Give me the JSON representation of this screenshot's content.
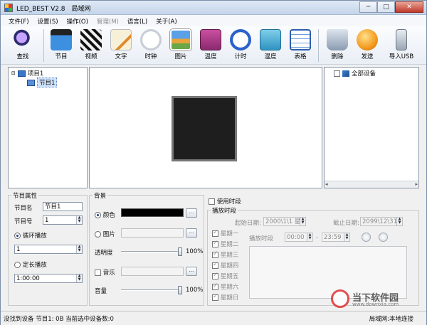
{
  "window": {
    "title": "LED_BEST V2.8　局域网",
    "minimize": "─",
    "maximize": "□",
    "close": "✕"
  },
  "menu": [
    {
      "label": "文件(F)",
      "enabled": true
    },
    {
      "label": "设置(S)",
      "enabled": true
    },
    {
      "label": "操作(O)",
      "enabled": true
    },
    {
      "label": "管理(M)",
      "enabled": false
    },
    {
      "label": "语言(L)",
      "enabled": true
    },
    {
      "label": "关于(A)",
      "enabled": true
    }
  ],
  "toolbar": {
    "find": "查找",
    "program": "节目",
    "video": "视频",
    "text": "文字",
    "clock": "时钟",
    "picture": "图片",
    "temperature": "温度",
    "timer": "计时",
    "humidity": "湿度",
    "table": "表格",
    "delete": "删除",
    "send": "发送",
    "export_usb": "导入USB"
  },
  "tree": {
    "root": "项目1",
    "child": "节目1"
  },
  "devices": {
    "all_devices": "全部设备"
  },
  "program_props": {
    "legend": "节目属性",
    "name_label": "节目名",
    "name_value": "节目1",
    "number_label": "节目号",
    "number_value": "1",
    "loop_label": "循环播放",
    "loop_value": "1",
    "fixed_label": "定长播放",
    "fixed_value": "1:00:00"
  },
  "background": {
    "legend": "背景",
    "color_label": "颜色",
    "color_value": "#000000",
    "picture_label": "图片",
    "browse": "...",
    "transparency_label": "透明度",
    "transparency_pct": "100%",
    "transparency": 1.0,
    "music_label": "音乐",
    "volume_label": "音量",
    "volume_pct": "100%",
    "volume": 1.0
  },
  "schedule": {
    "enable_label": "使用时段",
    "legend": "播放时段",
    "start_date_label": "起始日期:",
    "start_date": "2000\\1\\1 星",
    "end_date_label": "截止日期:",
    "end_date": "2099\\12\\31",
    "days": [
      "星期一",
      "星期二",
      "星期三",
      "星期四",
      "星期五",
      "星期六",
      "星期日"
    ],
    "time_label": "播放时段",
    "time_start": "00:00",
    "time_sep": "-",
    "time_end": "23:59"
  },
  "status": {
    "left": "没找到设备  节目1: 0B  当前选中设备数:0",
    "right": "局域网:本地连接"
  },
  "watermark": {
    "text": "当下软件园",
    "url": "www.downxia.com"
  }
}
